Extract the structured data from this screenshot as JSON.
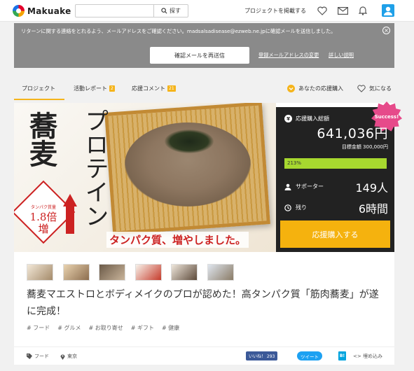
{
  "header": {
    "logo_text": "Makuake",
    "search_button": "探す",
    "post_link": "プロジェクトを掲載する",
    "icons": [
      "heart-icon",
      "mail-icon",
      "bell-icon",
      "user-avatar-icon"
    ]
  },
  "notice": {
    "message": "リターンに関する連絡をとれるよう、メールアドレスをご確認ください。madsalsadisease@ezweb.ne.jpに確認メールを送信しました。",
    "resend_button": "確認メールを再送信",
    "change_email_link": "登録メールアドレスの変更",
    "details_link": "詳しい説明",
    "close": "×"
  },
  "tabs": {
    "items": [
      {
        "label": "プロジェクト",
        "badge": ""
      },
      {
        "label": "活動レポート",
        "badge": "2"
      },
      {
        "label": "応援コメント",
        "badge": "21"
      }
    ],
    "support_purchase": "あなたの応援購入",
    "favorite": "気になる"
  },
  "hero": {
    "soba": "蕎麦",
    "protein": "プロテイン",
    "badge_small": "タンパク質量",
    "badge_big": "1.8倍",
    "badge_zo": "増",
    "tagline": "タンパク質、増やしました。"
  },
  "stats": {
    "success_badge": "Success!",
    "total_label": "応援購入総額",
    "amount": "641,036円",
    "goal": "目標金額 300,000円",
    "progress_text": "213%",
    "progress_percent": 213,
    "supporters_label": "サポーター",
    "supporters_value": "149人",
    "remaining_label": "残り",
    "remaining_value": "6時間",
    "buy_button": "応援購入する"
  },
  "project": {
    "title": "蕎麦マエストロとボディメイクのプロが認めた！高タンパク質「筋肉蕎麦」が遂に完成！",
    "tags": [
      "# フード",
      "# グルメ",
      "# お取り寄せ",
      "# ギフト",
      "# 健康"
    ]
  },
  "footer": {
    "category": "フード",
    "location": "東京",
    "facebook": "いいね！ 293",
    "tweet": "ツイート",
    "hatena": "B!",
    "embed": "<> 埋め込み"
  },
  "colors": {
    "accent": "#f5b20e",
    "progress": "#a7d82f",
    "success": "#e64a8a",
    "avatar": "#1fa0e8"
  }
}
